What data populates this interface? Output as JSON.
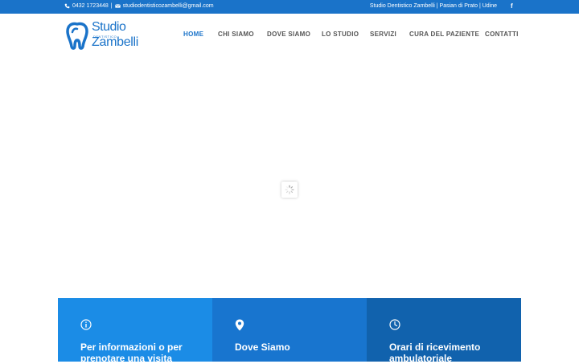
{
  "topbar": {
    "phone": "0432 1723448",
    "separator": "|",
    "email": "studiodentisticozambelli@gmail.com",
    "location": "Studio Dentistico Zambelli | Pasian di Prato | Udine",
    "social_label": "f"
  },
  "logo": {
    "line1": "Studio",
    "line2": "DENTISTICO",
    "line3": "Zambelli"
  },
  "nav": {
    "items": [
      "HOME",
      "CHI SIAMO",
      "DOVE SIAMO",
      "LO STUDIO",
      "SERVIZI",
      "CURA DEL PAZIENTE",
      "CONTATTI"
    ],
    "active": "HOME"
  },
  "boxes": [
    {
      "icon": "info-icon",
      "title": "Per informazioni o per prenotare una visita"
    },
    {
      "icon": "map-pin-icon",
      "title": "Dove Siamo"
    },
    {
      "icon": "clock-icon",
      "title": "Orari di ricevimento ambulatoriale"
    }
  ],
  "colors": {
    "brand": "#1a73c9",
    "box1": "#1b8ce6",
    "box2": "#1875cf",
    "box3": "#1162ad"
  }
}
